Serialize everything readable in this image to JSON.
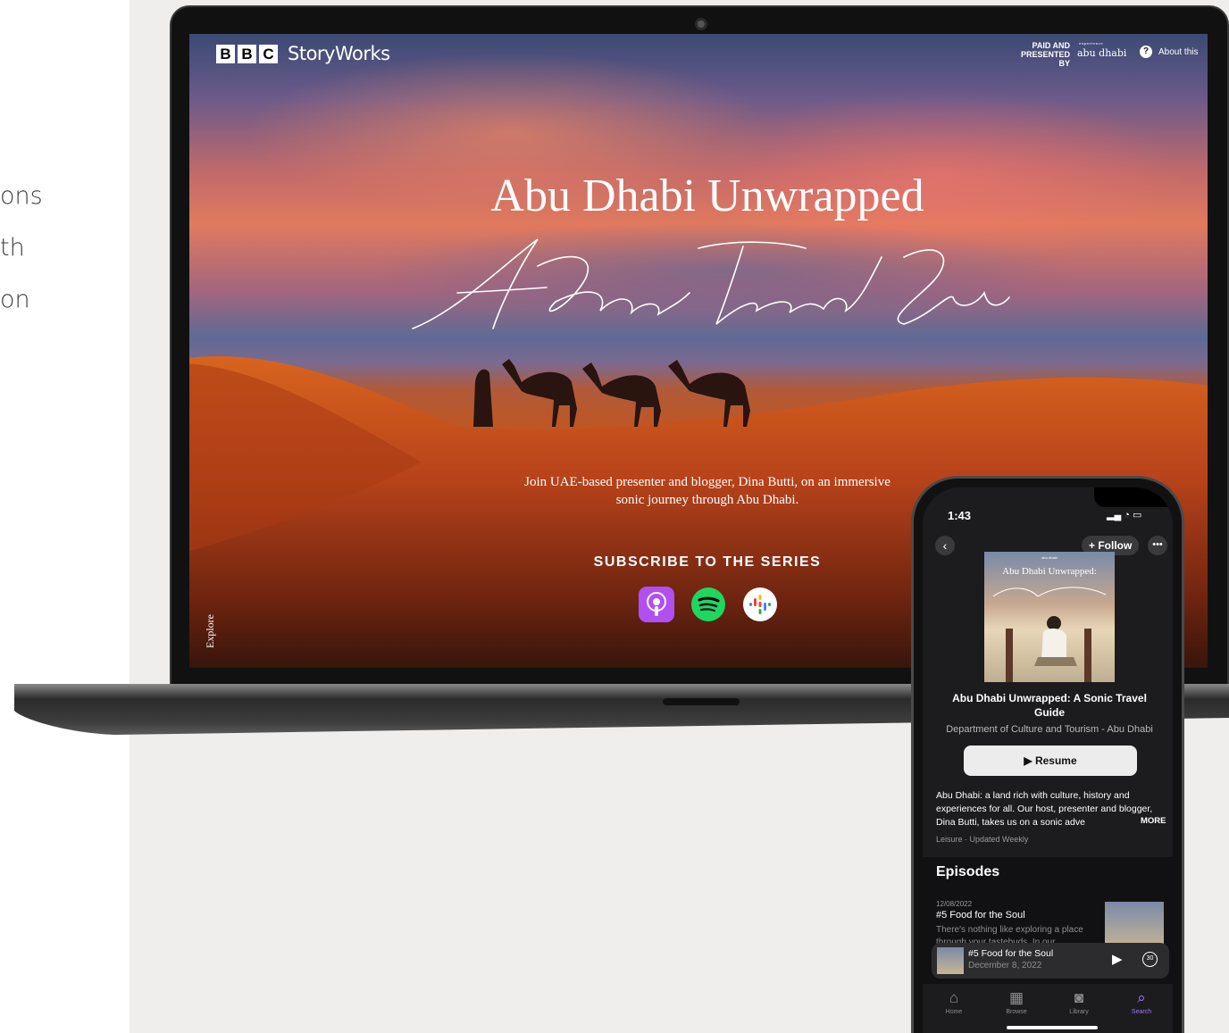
{
  "left_text": [
    "ons",
    "th",
    "on"
  ],
  "site": {
    "brand_boxes": [
      "B",
      "B",
      "C"
    ],
    "brand_name": "StoryWorks",
    "paid_label": "PAID AND PRESENTED BY",
    "partner_name": "abu dhabi",
    "partner_tagline": "experience",
    "about_label": "About this",
    "about_icon": "help-circle-icon",
    "hero_title": "Abu Dhabi Unwrapped",
    "hero_script": "A Sonic Travel Guide",
    "hero_description": "Join UAE-based presenter and blogger, Dina Butti, on an immersive sonic journey through Abu Dhabi.",
    "subscribe_title": "SUBSCRIBE TO THE SERIES",
    "platforms": [
      "apple-podcasts-icon",
      "spotify-icon",
      "google-podcasts-icon"
    ],
    "explore_label": "Explore",
    "colors": {
      "apple": "#b14ff1",
      "spotify": "#1ed760"
    }
  },
  "phone": {
    "time": "1:43",
    "back_icon": "chevron-left-icon",
    "follow_label": "+ Follow",
    "more_icon": "ellipsis-icon",
    "cover_title": "Abu Dhabi Unwrapped:",
    "cover_script": "A Sonic Travel Guide",
    "podcast_title": "Abu Dhabi Unwrapped: A Sonic Travel Guide",
    "podcast_author": "Department of Culture and Tourism - Abu Dhabi",
    "resume_label": "▶ Resume",
    "description": "Abu Dhabi: a land rich with culture, history and experiences for all. Our host, presenter and blogger, Dina Butti, takes us on a sonic adve",
    "more_label": "MORE",
    "genre": "Leisure · Updated Weekly",
    "episodes_heading": "Episodes",
    "episode": {
      "date": "12/08/2022",
      "title": "#5 Food for the Soul",
      "description": "There's nothing like exploring a place through your tastebuds. In our"
    },
    "now_playing": {
      "title": "#5 Food for the Soul",
      "date": "December 8, 2022",
      "skip": "30"
    },
    "tabs": [
      {
        "label": "Home",
        "icon": "home-icon",
        "glyph": "⌂"
      },
      {
        "label": "Browse",
        "icon": "grid-icon",
        "glyph": "▦"
      },
      {
        "label": "Library",
        "icon": "library-icon",
        "glyph": "◙"
      },
      {
        "label": "Search",
        "icon": "search-icon",
        "glyph": "⌕"
      }
    ],
    "accent": "#a474ff"
  }
}
